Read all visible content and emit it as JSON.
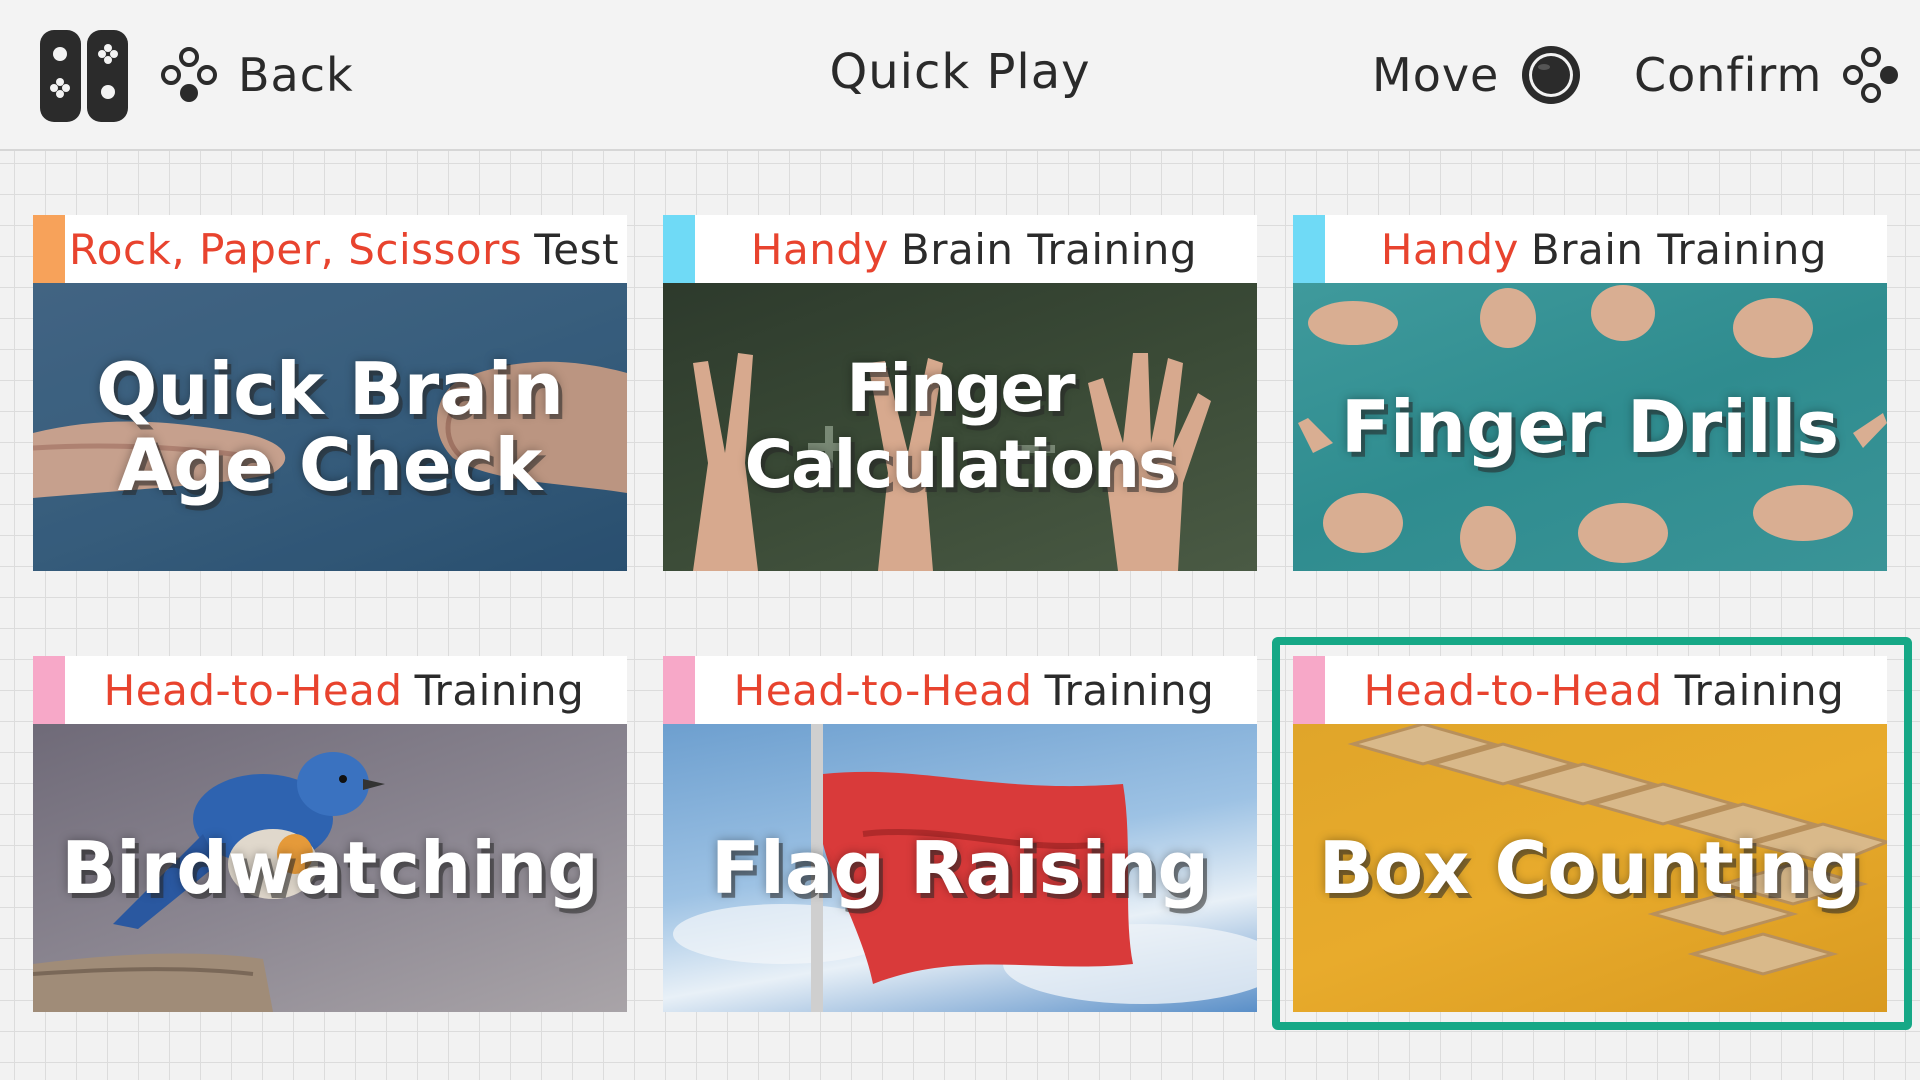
{
  "header": {
    "title": "Quick Play",
    "back_label": "Back",
    "move_label": "Move",
    "confirm_label": "Confirm"
  },
  "cards": [
    {
      "category_accent": "Rock, Paper, Scissors",
      "category_rest": "Test",
      "stripe_color": "#f7a25a",
      "title_line1": "Quick Brain",
      "title_line2": "Age Check",
      "image_subject": "hands playing rock paper scissors"
    },
    {
      "category_accent": "Handy",
      "category_rest": "Brain Training",
      "stripe_color": "#6fdaf6",
      "title_line1": "Finger Calculations",
      "image_subject": "raised fingers in front of chalkboard"
    },
    {
      "category_accent": "Handy",
      "category_rest": "Brain Training",
      "stripe_color": "#6fdaf6",
      "title_line1": "Finger Drills",
      "image_subject": "many hands on teal background"
    },
    {
      "category_accent": "Head-to-Head",
      "category_rest": "Training",
      "stripe_color": "#f7a8c8",
      "title_line1": "Birdwatching",
      "image_subject": "blue bird on a stump"
    },
    {
      "category_accent": "Head-to-Head",
      "category_rest": "Training",
      "stripe_color": "#f7a8c8",
      "title_line1": "Flag Raising",
      "image_subject": "red flag against blue sky"
    },
    {
      "category_accent": "Head-to-Head",
      "category_rest": "Training",
      "stripe_color": "#f7a8c8",
      "title_line1": "Box Counting",
      "image_subject": "wooden cubes on yellow background",
      "selected": true
    }
  ],
  "colors": {
    "accent_text": "#e8432e",
    "selection": "#16a886"
  },
  "icons": {
    "controller": "joycon-icon",
    "back": "buttons-b-icon",
    "move": "stick-icon",
    "confirm": "buttons-a-icon"
  }
}
